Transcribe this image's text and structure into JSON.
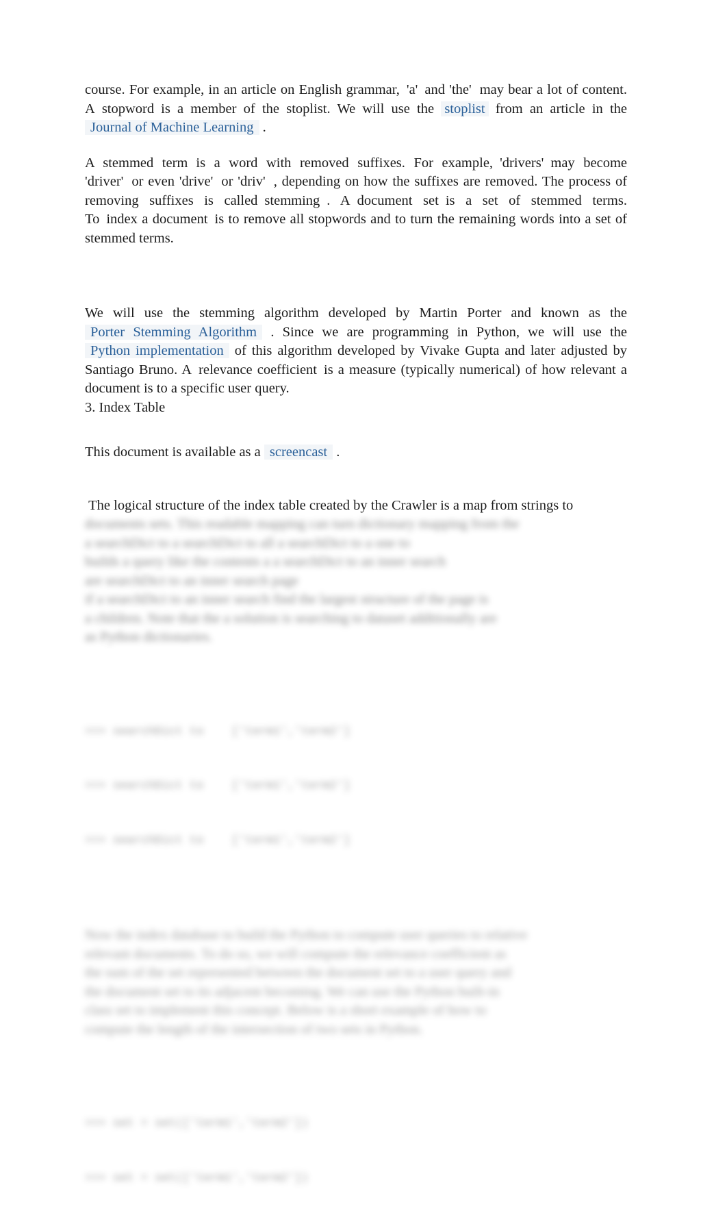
{
  "document": {
    "page_background": "#ffffff",
    "text_color": "#1c1c1c",
    "link_color": "#2a6099",
    "link_highlight": "#f2f5f8"
  },
  "paragraphs": {
    "p1": {
      "seg1": "course. For example, in an article on English grammar,",
      "term_a": "'a'",
      "seg2": "and",
      "term_the": "'the'",
      "seg3": "may bear a lot of content.",
      "seg4": "A",
      "term_stopword": "stopword",
      "seg5": "is a member of the stoplist. We will use the",
      "link_stoplist": "stoplist",
      "seg6": "from an article in the",
      "link_jmlr": "Journal of Machine Learning",
      "seg7": "."
    },
    "p2": {
      "term_stemmed": "A stemmed term",
      "seg1": "is a word with removed suffixes. For example,",
      "term_drivers": "'drivers'",
      "seg2": "may become",
      "term_driver": "'driver'",
      "seg3": "or even",
      "term_drive": "'drive'",
      "seg4": "or",
      "term_driv": "'driv'",
      "seg5": ", depending on how the suffixes are removed. The process of removing suffixes is called",
      "term_stemming": "stemming",
      "seg6": ". A",
      "term_docset": "document set",
      "seg7": "is a set of stemmed terms. To",
      "term_index": "index a document",
      "seg8": "is to remove all stopwords and to turn the remaining words into a set of stemmed terms."
    },
    "p3": {
      "seg1": "We will use the stemming algorithm developed by Martin Porter and known as the",
      "link_porter": "Porter Stemming Algorithm",
      "seg2": ". Since we are programming in Python, we will use the",
      "link_python": "Python implementation",
      "seg3": "of this algorithm developed by Vivake Gupta and later adjusted by Santiago Bruno.",
      "seg4": "A",
      "term_relevance": "relevance coefficient",
      "seg5": "is a measure (typically numerical) of how relevant a document is to a specific user query."
    },
    "heading_index_table": "3. Index Table",
    "p4": {
      "seg1": "This document is available as a",
      "link_screencast": "screencast",
      "seg2": "."
    },
    "p5": {
      "seg1": "The logical structure of the index table created by the Crawler is a map from strings to"
    }
  },
  "blurred": {
    "note": "unreadable",
    "paragraph_a": [
      "documents sets. This readable mapping can turn dictionary mapping from the",
      "a searchDict to a searchDict to all a searchDict to a one to",
      "builds a query like the contents a a searchDict to an inner search",
      "are searchDict to an inner search page",
      "if a searchDict to an inner search find the largest structure of the page is",
      "a children. Note that the a solution is searching to dataset additionally are",
      "as Python dictionaries."
    ],
    "code_a": [
      ">>> searchDict to    ['term1','term2']",
      ">>> searchDict to    ['term1','term2']",
      ">>> searchDict to    ['term1','term2']"
    ],
    "paragraph_b": [
      "Now the index database to build the Python to compute user queries to relative",
      "relevant documents. To do so, we will compute the relevance coefficient as",
      "the sum of the set represented between the document set to a user query and",
      "the document set to its adjacent becoming. We can use the Python built-in",
      "class set to implement this concept. Below is a short example of how to",
      "compute the length of the intersection of two sets in Python."
    ],
    "code_b": [
      ">>> set = set(['term1','term2'])",
      ">>> set = set(['term1','term2'])"
    ]
  }
}
